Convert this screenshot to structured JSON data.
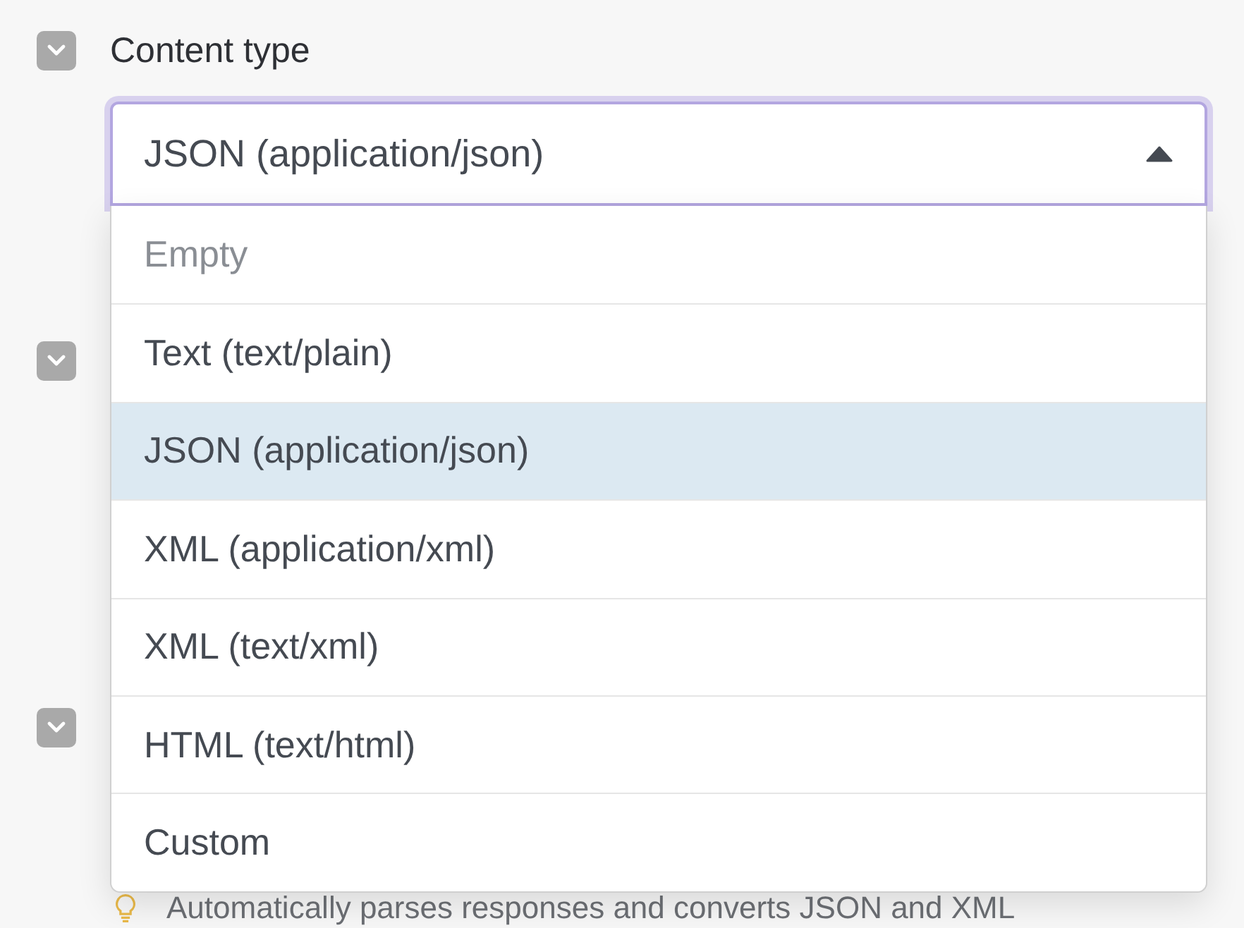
{
  "sections": [
    {
      "label": "Content type",
      "expanded": true
    },
    {
      "expanded": true
    },
    {
      "expanded": true
    }
  ],
  "select": {
    "value": "JSON (application/json)",
    "open": true,
    "options": [
      {
        "label": "Empty",
        "kind": "placeholder",
        "selected": false
      },
      {
        "label": "Text (text/plain)",
        "kind": "option",
        "selected": false
      },
      {
        "label": "JSON (application/json)",
        "kind": "option",
        "selected": true
      },
      {
        "label": "XML (application/xml)",
        "kind": "option",
        "selected": false
      },
      {
        "label": "XML (text/xml)",
        "kind": "option",
        "selected": false
      },
      {
        "label": "HTML (text/html)",
        "kind": "option",
        "selected": false
      },
      {
        "label": "Custom",
        "kind": "option",
        "selected": false
      }
    ]
  },
  "hint": "Automatically parses responses and converts JSON and XML"
}
